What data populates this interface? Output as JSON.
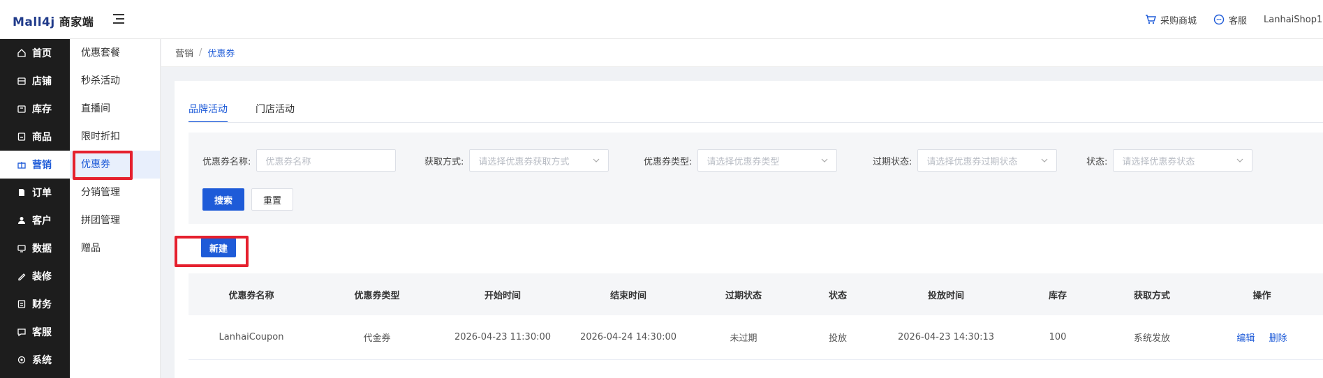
{
  "header": {
    "logo_brand": "Mall4j",
    "logo_sub": "商家端",
    "purchase_mall": "采购商城",
    "customer_service": "客服",
    "username": "LanhaiShop1"
  },
  "sidebar": {
    "items": [
      {
        "label": "首页",
        "icon": "home-icon"
      },
      {
        "label": "店铺",
        "icon": "shop-icon"
      },
      {
        "label": "库存",
        "icon": "inventory-icon"
      },
      {
        "label": "商品",
        "icon": "goods-icon"
      },
      {
        "label": "营销",
        "icon": "gift-icon"
      },
      {
        "label": "订单",
        "icon": "order-icon"
      },
      {
        "label": "客户",
        "icon": "user-icon"
      },
      {
        "label": "数据",
        "icon": "data-icon"
      },
      {
        "label": "装修",
        "icon": "decoration-icon"
      },
      {
        "label": "财务",
        "icon": "finance-icon"
      },
      {
        "label": "客服",
        "icon": "chat-icon"
      },
      {
        "label": "系统",
        "icon": "gear-icon"
      }
    ],
    "active": "营销"
  },
  "submenu": {
    "items": [
      "优惠套餐",
      "秒杀活动",
      "直播间",
      "限时折扣",
      "优惠券",
      "分销管理",
      "拼团管理",
      "赠品"
    ],
    "active": "优惠券"
  },
  "breadcrumb": {
    "parent": "营销",
    "separator": "/",
    "current": "优惠券"
  },
  "tabs": [
    "品牌活动",
    "门店活动"
  ],
  "search": {
    "name_label": "优惠券名称:",
    "name_placeholder": "优惠券名称",
    "method_label": "获取方式:",
    "method_placeholder": "请选择优惠券获取方式",
    "type_label": "优惠券类型:",
    "type_placeholder": "请选择优惠券类型",
    "expire_label": "过期状态:",
    "expire_placeholder": "请选择优惠券过期状态",
    "status_label": "状态:",
    "status_placeholder": "请选择优惠券状态",
    "search_button": "搜索",
    "reset_button": "重置"
  },
  "new_button": "新建",
  "table": {
    "columns": [
      "优惠券名称",
      "优惠券类型",
      "开始时间",
      "结束时间",
      "过期状态",
      "状态",
      "投放时间",
      "库存",
      "获取方式",
      "操作"
    ],
    "rows": [
      {
        "name": "LanhaiCoupon",
        "type": "代金券",
        "start": "2026-04-23 11:30:00",
        "end": "2026-04-24 14:30:00",
        "expire": "未过期",
        "status": "投放",
        "release": "2026-04-23 14:30:13",
        "stock": "100",
        "method": "系统发放",
        "edit": "编辑",
        "delete": "删除"
      }
    ]
  },
  "colors": {
    "primary": "#1e5bd8",
    "sidebar_bg": "#1d1d1d",
    "highlight": "#e5202e"
  }
}
